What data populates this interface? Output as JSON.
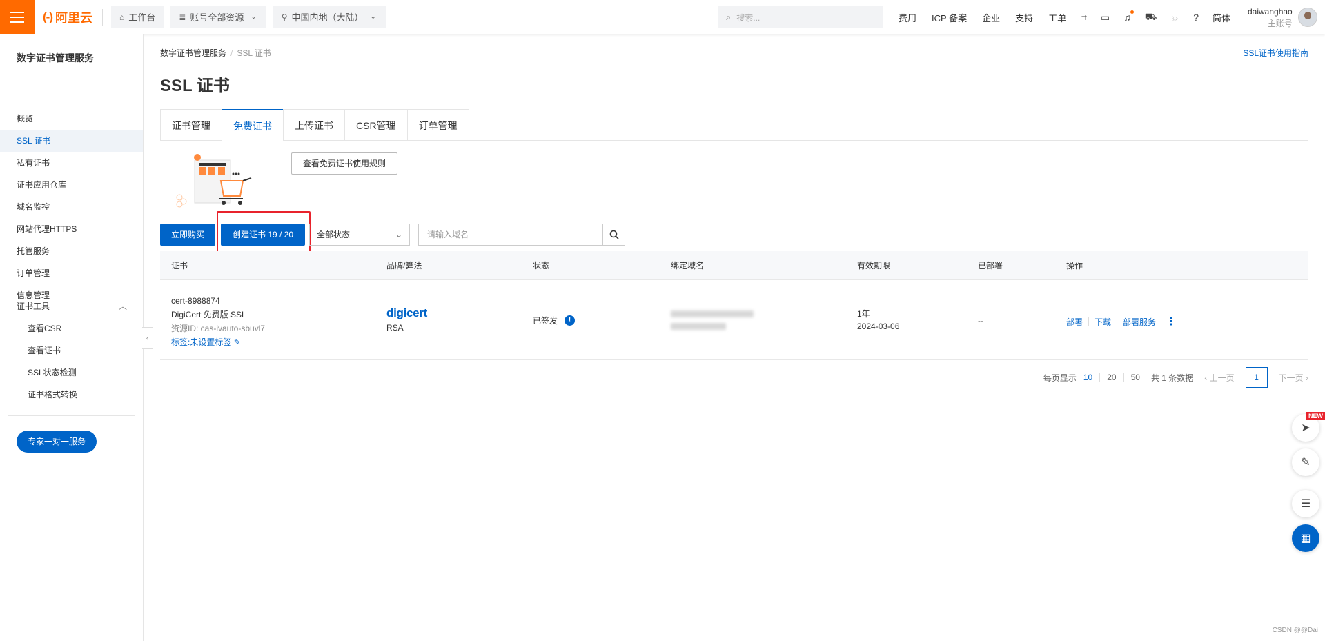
{
  "topbar": {
    "logo_mark": "(-)",
    "logo_text": "阿里云",
    "workbench": "工作台",
    "resources": "账号全部资源",
    "region": "中国内地（大陆）",
    "search_placeholder": "搜索...",
    "links": [
      "费用",
      "ICP 备案",
      "企业",
      "支持",
      "工单"
    ],
    "lang": "简体",
    "username": "daiwanghao",
    "user_role": "主账号"
  },
  "sidebar": {
    "title": "数字证书管理服务",
    "items": [
      "概览",
      "SSL 证书",
      "私有证书",
      "证书应用仓库",
      "域名监控",
      "网站代理HTTPS",
      "托管服务",
      "订单管理",
      "信息管理"
    ],
    "group_title": "证书工具",
    "tools": [
      "查看CSR",
      "查看证书",
      "SSL状态检测",
      "证书格式转换"
    ],
    "expert_button": "专家一对一服务"
  },
  "breadcrumb": {
    "root": "数字证书管理服务",
    "current": "SSL 证书"
  },
  "guide_link": "SSL证书使用指南",
  "page_title": "SSL 证书",
  "tabs": [
    "证书管理",
    "免费证书",
    "上传证书",
    "CSR管理",
    "订单管理"
  ],
  "toolbar": {
    "rules_button": "查看免费证书使用规则",
    "buy_button": "立即购买",
    "create_button": "创建证书 19 / 20",
    "status_select": "全部状态",
    "domain_placeholder": "请输入域名"
  },
  "table": {
    "headers": [
      "证书",
      "品牌/算法",
      "状态",
      "绑定域名",
      "有效期限",
      "已部署",
      "操作"
    ],
    "row": {
      "cert_name": "cert-8988874",
      "cert_type": "DigiCert 免费版 SSL",
      "resource_id": "资源ID: cas-ivauto-sbuvl7",
      "tag": "标签:未设置标签",
      "brand": "digicert",
      "algorithm": "RSA",
      "status": "已签发",
      "validity_term": "1年",
      "validity_date": "2024-03-06",
      "deployed": "--",
      "ops": [
        "部署",
        "下载",
        "部署服务"
      ]
    }
  },
  "pagination": {
    "label": "每页显示",
    "sizes": [
      "10",
      "20",
      "50"
    ],
    "total": "共 1 条数据",
    "prev": "上一页",
    "page": "1",
    "next": "下一页"
  },
  "float_badge": "NEW",
  "watermark": "CSDN @@Dai",
  "colors": {
    "brand": "#ff6a00",
    "primary": "#0064c8",
    "highlight": "#e8232c"
  }
}
